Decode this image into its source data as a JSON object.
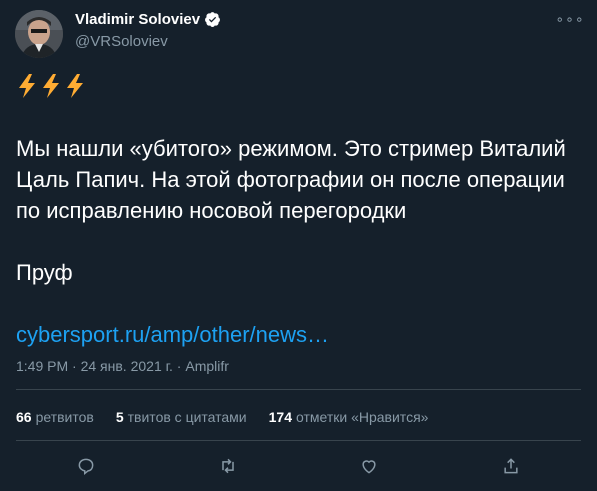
{
  "author": {
    "name": "Vladimir Soloviev",
    "handle": "@VRSoloviev"
  },
  "more_label": "∘∘∘",
  "tweet": {
    "emoji": [
      "high-voltage",
      "high-voltage",
      "high-voltage"
    ],
    "paragraph1": "Мы нашли «убитого» режимом. Это стример Виталий Цаль Папич. На этой фотографии он после операции по исправлению носовой перегородки",
    "paragraph2": "Пруф",
    "link": "cybersport.ru/amp/other/news…"
  },
  "meta": {
    "time": "1:49 PM",
    "separator1": " · ",
    "date": "24 янв. 2021 г.",
    "separator2": " · ",
    "source": "Amplifr"
  },
  "stats": {
    "retweets_count": "66",
    "retweets_label": "ретвитов",
    "quotes_count": "5",
    "quotes_label": "твитов с цитатами",
    "likes_count": "174",
    "likes_label": "отметки «Нравится»"
  },
  "colors": {
    "background": "#15202b",
    "text": "#ffffff",
    "secondary": "#8899a6",
    "link": "#1da1f2",
    "divider": "#38444d",
    "bolt": "#ffac33"
  }
}
